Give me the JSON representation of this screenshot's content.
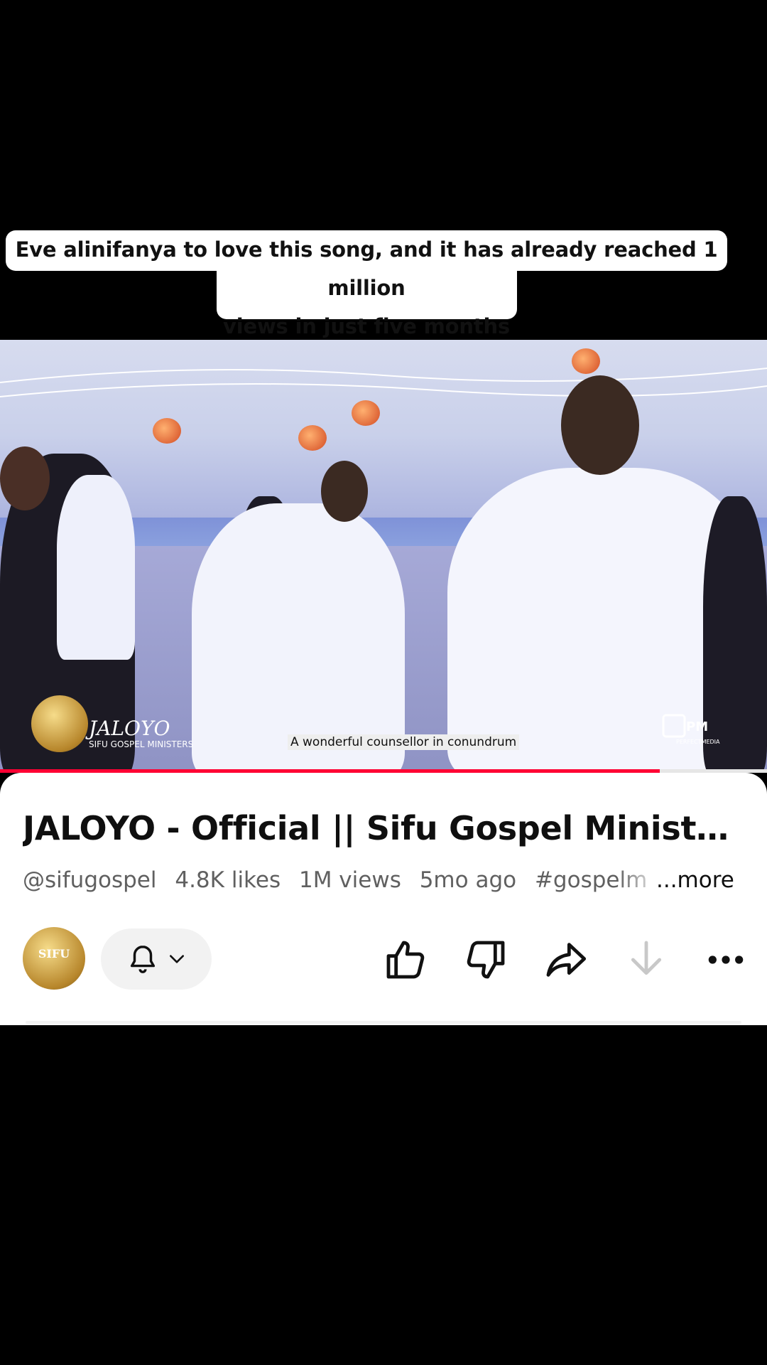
{
  "caption": {
    "line1": "Eve alinifanya to love this song, and it has already reached 1 million",
    "line2": "views in just five months"
  },
  "video": {
    "overlay_title": "JALOYO",
    "overlay_ministry": "SIFU GOSPEL MINISTERS",
    "subtitle": "A wonderful counsellor in conundrum",
    "watermark": "PERFECTMEDIA",
    "progress_fraction": 0.86
  },
  "details": {
    "title": "JALOYO - Official || Sifu Gospel Ministers",
    "channel": "@sifugospel",
    "likes": "4.8K likes",
    "views": "1M views",
    "age": "5mo ago",
    "hashtag": "#gospelm",
    "more_label": "...more"
  },
  "channel_avatar_text": "SIFU",
  "actions": {
    "bell_icon": "bell-icon",
    "chevron_icon": "chevron-down-icon",
    "like_icon": "thumbs-up-icon",
    "dislike_icon": "thumbs-down-icon",
    "share_icon": "share-icon",
    "download_icon": "download-icon",
    "menu_icon": "more-horizontal-icon"
  }
}
